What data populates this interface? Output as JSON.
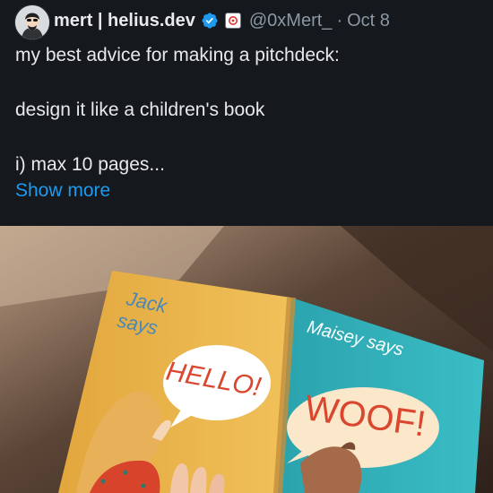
{
  "tweet": {
    "display_name": "mert | helius.dev",
    "handle": "@0xMert_",
    "separator": "·",
    "date": "Oct 8",
    "verified_icon": "verified-badge-icon",
    "affiliate_icon": "helius-affiliate-badge-icon",
    "text_lines": [
      "my best advice for making a pitchdeck:",
      "design it like a children's book",
      "i) max 10 pages..."
    ],
    "show_more_label": "Show more"
  },
  "media": {
    "book_left_line1": "Jack",
    "book_left_line2": "says",
    "book_left_bubble": "HELLO!",
    "book_right_title": "Maisey says",
    "book_right_bubble": "WOOF!"
  },
  "colors": {
    "background": "#15181c",
    "text": "#e7e9ea",
    "secondary_text": "#8b98a5",
    "link": "#1d9bf0",
    "verified_blue": "#1d9bf0",
    "affiliate_red": "#e0342f"
  }
}
